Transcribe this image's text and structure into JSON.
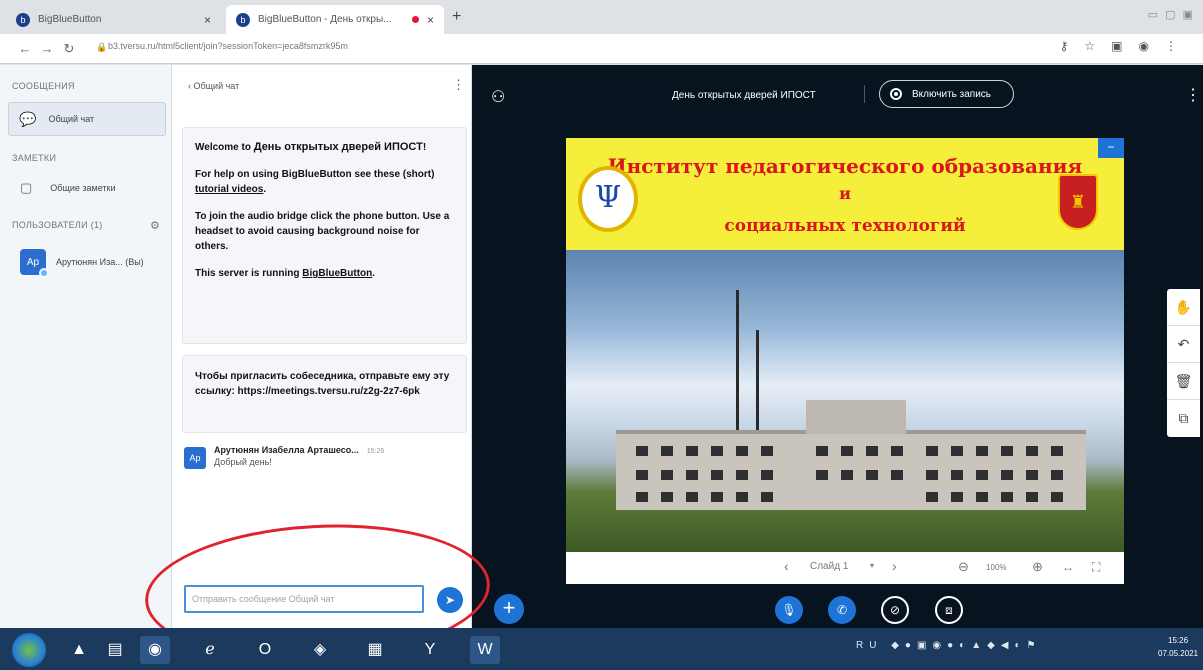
{
  "browser": {
    "tabs": [
      {
        "title": "BigBlueButton",
        "close": "×"
      },
      {
        "title": "BigBlueButton - День откры...",
        "close": "×"
      }
    ],
    "new_tab": "+",
    "url": "b3.tversu.ru/html5client/join?sessionToken=jeca8fsmzrk95m",
    "window_controls": "▭ ▢ ▣"
  },
  "sidebar": {
    "messages_header": "СООБЩЕНИЯ",
    "public_chat": "Общий чат",
    "notes_header": "ЗАМЕТКИ",
    "shared_notes": "Общие заметки",
    "users_header": "ПОЛЬЗОВАТЕЛИ (1)",
    "user": {
      "initials": "Ар",
      "name": "Арутюнян Иза... (Вы)"
    }
  },
  "chat": {
    "back_label": "Общий чат",
    "welcome": {
      "prefix": "Welcome to ",
      "meeting": "День открытых дверей ИПОСТ",
      "suffix": "!",
      "help_prefix": "For help on using BigBlueButton see these (short) ",
      "help_link": "tutorial videos",
      "help_suffix": ".",
      "audio": "To join the audio bridge click the phone button. Use a headset to avoid causing background noise for others.",
      "server_prefix": "This server is running ",
      "server_link": "BigBlueButton",
      "server_suffix": "."
    },
    "invite": "Чтобы пригласить собеседника, отправьте ему эту ссылку: https://meetings.tversu.ru/z2g-2z7-6pk",
    "message": {
      "initials": "Ар",
      "author": "Арутюнян Изабелла Арташесо...",
      "time": "15:26",
      "text": "Добрый день!"
    },
    "input_placeholder": "Отправить сообщение Общий чат"
  },
  "stage": {
    "meeting_title": "День открытых дверей ИПОСТ",
    "record_label": "Включить запись",
    "slide": {
      "line1": "Институт педагогического образования",
      "line2": "и",
      "line3": "социальных технологий",
      "label": "Слайд 1",
      "zoom": "100%"
    }
  },
  "taskbar": {
    "lang": "RU",
    "time": "15:26",
    "date": "07.05.2021"
  },
  "colors": {
    "accent": "#1d74d6",
    "stage_bg": "#07131f",
    "banner": "#f5ee3a",
    "banner_text": "#d8161c",
    "annotation": "#e0242f"
  }
}
